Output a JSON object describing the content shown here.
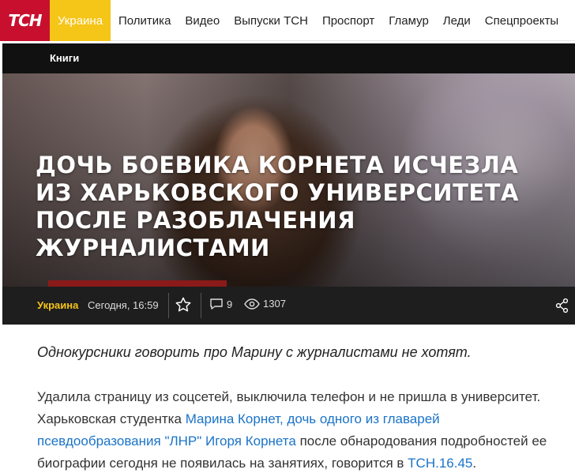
{
  "nav": {
    "logo": "ТСН",
    "active": "Украина",
    "items": [
      "Политика",
      "Видео",
      "Выпуски ТСН",
      "Проспорт",
      "Гламур",
      "Леди",
      "Спецпроекты"
    ]
  },
  "hero": {
    "section": "Книги",
    "headline": "Дочь боевика Корнета исчезла из Харьковского университета после разоблачения журналистами",
    "meta": {
      "category": "Украина",
      "time": "Сегодня, 16:59",
      "comments": "9",
      "views": "1307"
    }
  },
  "article": {
    "lead": "Однокурсники говорить про Марину с журналистами не хотят.",
    "p1_start": "Удалила страницу из соцсетей, выключила телефон и не пришла в университет. Харьковская студентка ",
    "p1_link1": "Марина Корнет, дочь одного из главарей псевдообразования \"ЛНР\" Игоря Корнета",
    "p1_mid": " после обнародования подробностей ее биографии сегодня не появилась на занятиях, говорится в ",
    "p1_link2": "ТСН.16.45",
    "p1_end": "."
  },
  "colors": {
    "brand_red": "#c8102e",
    "active_yellow": "#f5c518",
    "link_blue": "#1a73c8"
  },
  "icons": [
    "star-icon",
    "comment-icon",
    "eye-icon",
    "share-icon"
  ]
}
